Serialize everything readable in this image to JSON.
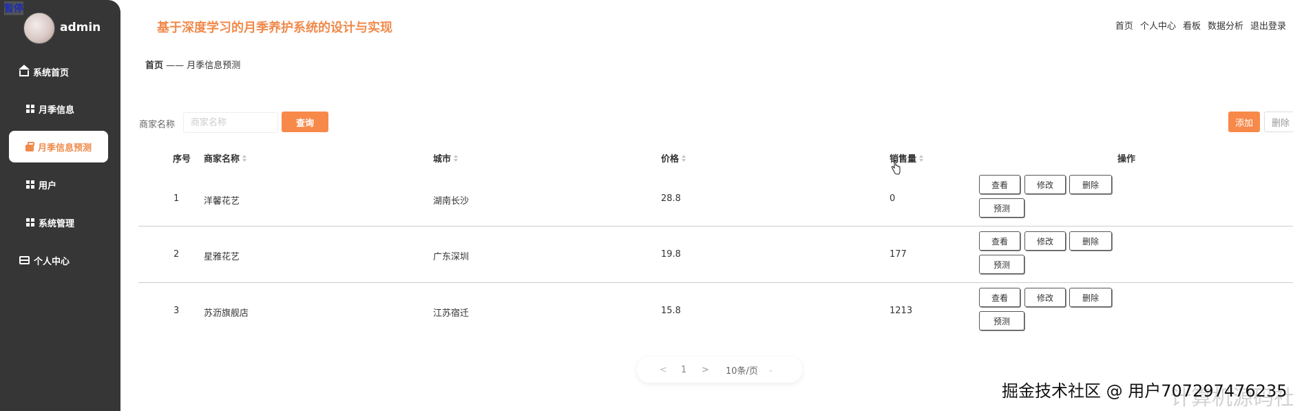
{
  "overlay": {
    "pause": "暂停"
  },
  "user": {
    "name": "admin"
  },
  "sidebar": {
    "items": [
      {
        "label": "系统首页",
        "icon": "home-icon"
      },
      {
        "label": "月季信息",
        "icon": "grid-icon"
      },
      {
        "label": "月季信息预测",
        "icon": "bag-icon",
        "active": true
      },
      {
        "label": "用户",
        "icon": "grid-icon"
      },
      {
        "label": "系统管理",
        "icon": "grid-icon"
      },
      {
        "label": "个人中心",
        "icon": "card-icon"
      }
    ]
  },
  "header": {
    "title": "基于深度学习的月季养护系统的设计与实现",
    "nav": [
      "首页",
      "个人中心",
      "看板",
      "数据分析",
      "退出登录"
    ]
  },
  "breadcrumb": {
    "home": "首页",
    "separator": "——",
    "current": "月季信息预测"
  },
  "search": {
    "label": "商家名称",
    "placeholder": "商家名称",
    "value": "",
    "query_button": "查询"
  },
  "toolbar": {
    "add": "添加",
    "delete": "删除"
  },
  "table": {
    "columns": [
      "序号",
      "商家名称",
      "城市",
      "价格",
      "销售量",
      "操作"
    ],
    "rows": [
      {
        "index": "1",
        "merchant": "洋馨花艺",
        "city": "湖南长沙",
        "price": "28.8",
        "sales": "0"
      },
      {
        "index": "2",
        "merchant": "星雅花艺",
        "city": "广东深圳",
        "price": "19.8",
        "sales": "177"
      },
      {
        "index": "3",
        "merchant": "苏沥旗舰店",
        "city": "江苏宿迁",
        "price": "15.8",
        "sales": "1213"
      }
    ],
    "actions": {
      "view": "查看",
      "edit": "修改",
      "delete": "删除",
      "predict": "预测"
    }
  },
  "pagination": {
    "prev": "<",
    "page": "1",
    "next": ">",
    "page_size": "10条/页",
    "size_arrow": "⌄"
  },
  "watermark": {
    "text": "掘金技术社区 @ 用户707297476235",
    "ghost": "计算机源码社"
  },
  "colors": {
    "accent": "#f7894a",
    "sidebar_bg": "#363636",
    "title": "#f08a4b"
  }
}
